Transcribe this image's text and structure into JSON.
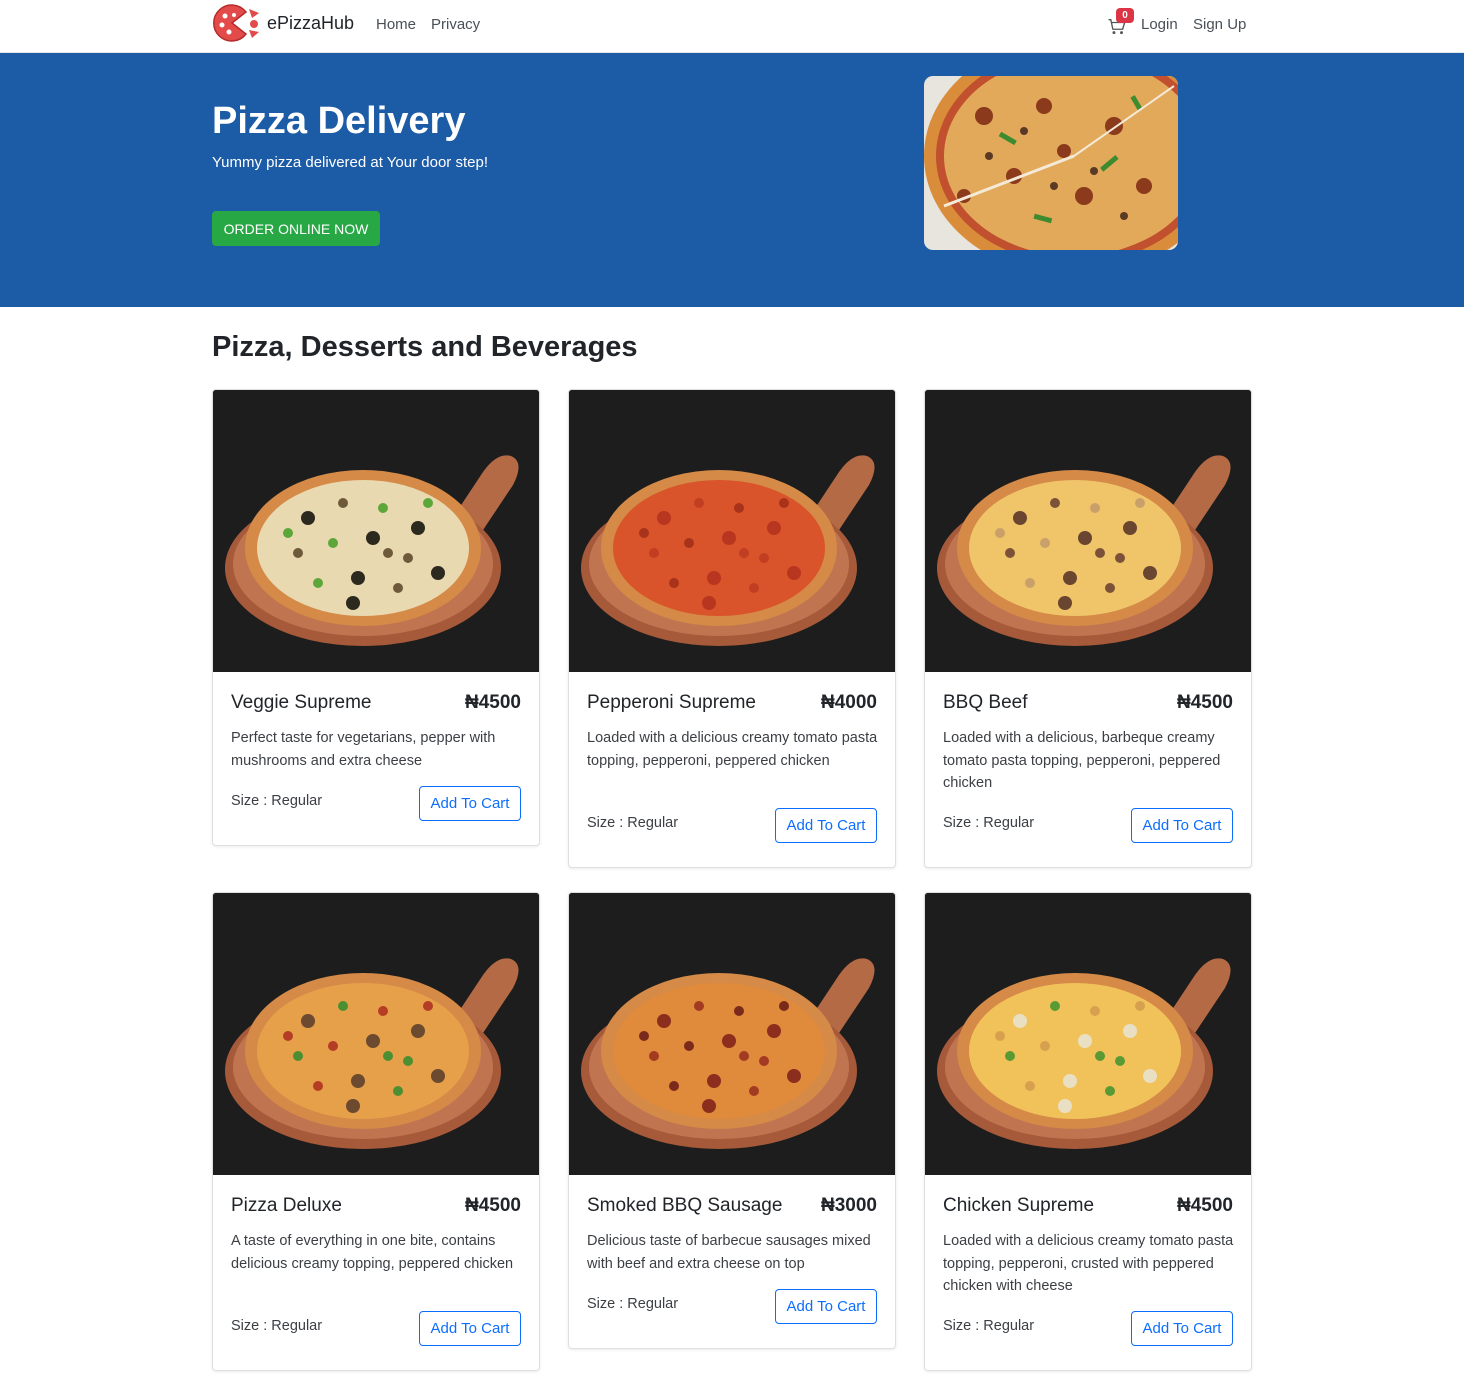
{
  "nav": {
    "brand": "ePizzaHub",
    "links": [
      "Home",
      "Privacy"
    ],
    "cart_count": "0",
    "login": "Login",
    "signup": "Sign Up"
  },
  "hero": {
    "title": "Pizza Delivery",
    "subtitle": "Yummy pizza delivered at Your door step!",
    "cta": "ORDER ONLINE NOW"
  },
  "section": {
    "title": "Pizza, Desserts and Beverages"
  },
  "products": [
    {
      "name": "Veggie Supreme",
      "price": "₦4500",
      "description": "Perfect taste for vegetarians, pepper with mushrooms and extra cheese",
      "size": "Size : Regular",
      "button": "Add To Cart"
    },
    {
      "name": "Pepperoni Supreme",
      "price": "₦4000",
      "description": "Loaded with a delicious creamy tomato pasta topping, pepperoni, peppered chicken",
      "size": "Size : Regular",
      "button": "Add To Cart"
    },
    {
      "name": "BBQ Beef",
      "price": "₦4500",
      "description": "Loaded with a delicious, barbeque creamy tomato pasta topping, pepperoni, peppered chicken",
      "size": "Size : Regular",
      "button": "Add To Cart"
    },
    {
      "name": "Pizza Deluxe",
      "price": "₦4500",
      "description": "A taste of everything in one bite, contains delicious creamy topping, peppered chicken",
      "size": "Size : Regular",
      "button": "Add To Cart"
    },
    {
      "name": "Smoked BBQ Sausage",
      "price": "₦3000",
      "description": "Delicious taste of barbecue sausages mixed with beef and extra cheese on top",
      "size": "Size : Regular",
      "button": "Add To Cart"
    },
    {
      "name": "Chicken Supreme",
      "price": "₦4500",
      "description": "Loaded with a delicious creamy tomato pasta topping, pepperoni, crusted with peppered chicken with cheese",
      "size": "Size : Regular",
      "button": "Add To Cart"
    }
  ],
  "colors": {
    "hero_bg": "#1c5ba5",
    "cta_green": "#28a745",
    "primary_blue": "#0d6efd",
    "badge_red": "#dc3545"
  },
  "icons": [
    "pizza-logo-icon",
    "cart-icon"
  ]
}
